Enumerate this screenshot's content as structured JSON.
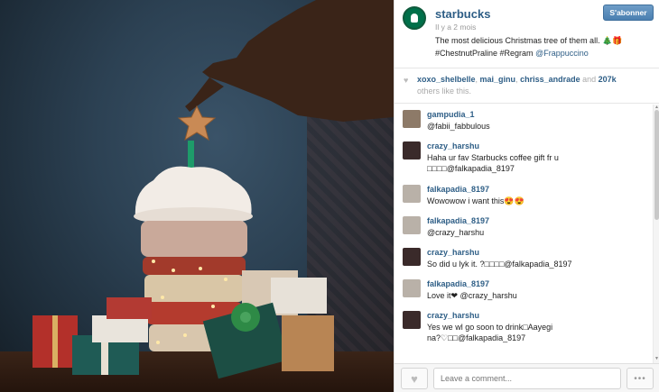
{
  "post": {
    "username": "starbucks",
    "time_ago": "Il y a 2 mois",
    "follow_label": "S'abonner",
    "caption_text": "The most delicious Christmas tree of them all. 🎄🎁",
    "caption_tags": "#ChestnutPraline #Regram",
    "caption_mention": "@Frappuccino"
  },
  "likes": {
    "users": [
      "xoxo_shelbelle",
      "mai_ginu",
      "chriss_andrade"
    ],
    "sep1": ", ",
    "sep2": ", ",
    "and_text": " and ",
    "count": "207k",
    "suffix": "others like this."
  },
  "comments": [
    {
      "name": "gampudia_1",
      "text": "@fabii_fabbulous"
    },
    {
      "name": "crazy_harshu",
      "text": "Haha ur fav Starbucks coffee gift fr u",
      "text2": "□□□□@falkapadia_8197"
    },
    {
      "name": "falkapadia_8197",
      "text": "Wowowow i want this😍😍"
    },
    {
      "name": "falkapadia_8197",
      "text": "@crazy_harshu"
    },
    {
      "name": "crazy_harshu",
      "text": "So did u lyk it. ?□□□□@falkapadia_8197"
    },
    {
      "name": "falkapadia_8197",
      "text": "Love it❤ @crazy_harshu"
    },
    {
      "name": "crazy_harshu",
      "text": "Yes we wl go soon to drink□Aayegi",
      "text2": "na?♡□□@falkapadia_8197"
    }
  ],
  "footer": {
    "comment_placeholder": "Leave a comment...",
    "more_label": "•••"
  },
  "colors": {
    "link": "#2e5e86",
    "follow_button": "#4a7fb1",
    "logo_green": "#00704a"
  }
}
